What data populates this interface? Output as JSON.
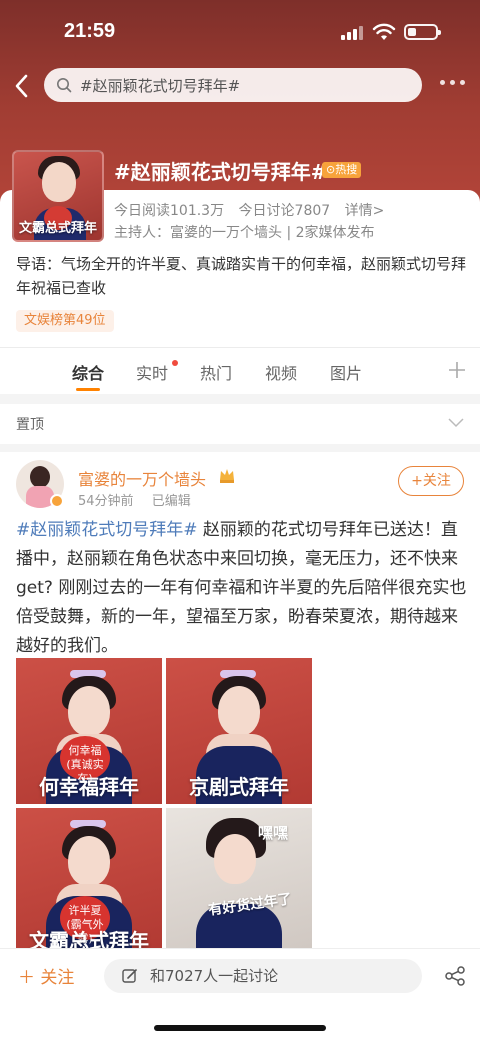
{
  "status_bar": {
    "time": "21:59"
  },
  "header": {
    "search_text": "#赵丽颖花式切号拜年#"
  },
  "topic": {
    "thumb_caption": "文霸总式拜年",
    "title": "#赵丽颖花式切号拜年#",
    "hot_label": "热搜",
    "reads": "今日阅读101.3万",
    "discussions": "今日讨论7807",
    "details_link": "详情>",
    "host_line": "主持人：富婆的一万个墙头 | 2家媒体发布",
    "intro": "导语：气场全开的许半夏、真诚踏实肯干的何幸福，赵丽颖式切号拜年祝福已查收",
    "rank": "文娱榜第49位"
  },
  "tabs": [
    {
      "label": "综合"
    },
    {
      "label": "实时"
    },
    {
      "label": "热门"
    },
    {
      "label": "视频"
    },
    {
      "label": "图片"
    }
  ],
  "pinned_label": "置顶",
  "post": {
    "author": "富婆的一万个墙头",
    "time": "54分钟前",
    "edited": "已编辑",
    "follow_label": "+关注",
    "hashtag": "#赵丽颖花式切号拜年#",
    "body": " 赵丽颖的花式切号拜年已送达！直播中，赵丽颖在角色状态中来回切换，毫无压力，还不快来get? 刚刚过去的一年有何幸福和许半夏的先后陪伴很充实也倍受鼓舞，新的一年，望福至万家，盼春荣夏浓，期待越来越好的我们。",
    "images": [
      {
        "label": "何幸福拜年",
        "sign": "何幸福\n(真诚实在)"
      },
      {
        "label": "京剧式拜年",
        "sign": ""
      },
      {
        "label": "文霸总式拜年",
        "sign": "许半夏\n(霸气外露)"
      },
      {
        "label": "有好货过年了",
        "sign": "",
        "bubble": "嘿嘿"
      }
    ]
  },
  "bottom_bar": {
    "follow_label": "关注",
    "discuss_label": "和7027人一起讨论"
  },
  "colors": {
    "accent": "#e8843b",
    "hashtag": "#4f7cba",
    "hero": "#a13d33"
  }
}
